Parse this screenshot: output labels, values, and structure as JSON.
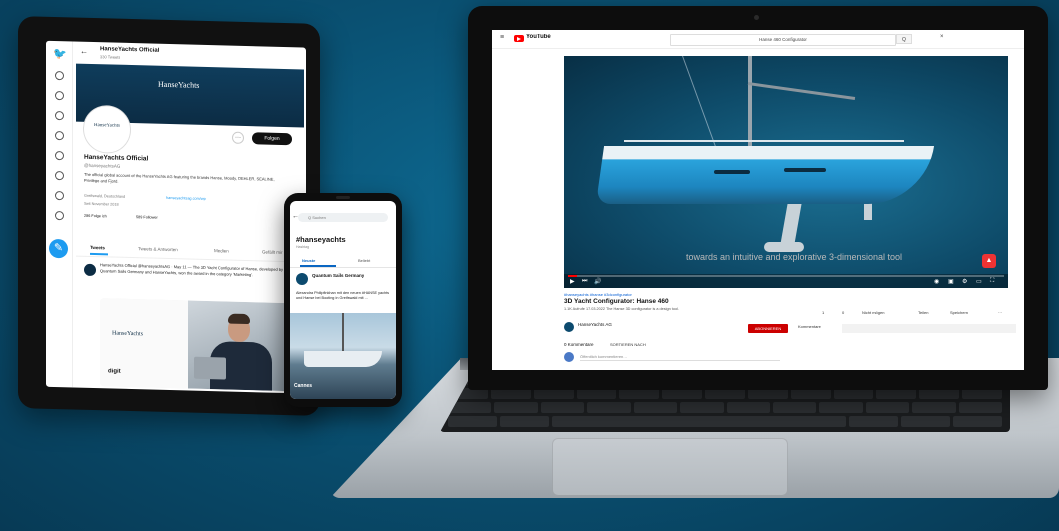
{
  "tablet": {
    "twitter": {
      "top_name": "HanseYachts Official",
      "top_sub": "330 Tweets",
      "banner_logo": "HanseYachts",
      "banner_sub": "",
      "avatar_text": "HanseYachts",
      "follow_label": "Folgen",
      "more_label": "···",
      "name": "HanseYachts Official",
      "handle": "@hanseyachtsAG",
      "bio": "The official global account of the HanseYachts AG featuring the brands Hanse, Moody, DEHLER, SEALINE, Privilège and Fjord.",
      "location": "Greifswald, Deutschland",
      "link": "hanseyachtsag.com/wp",
      "joined": "Seit November 2018",
      "following": "286 Folge ich",
      "followers": "589 Follower",
      "tabs": [
        "Tweets",
        "Tweets & Antworten",
        "Medien",
        "Gefällt mir"
      ],
      "post_text": "HanseYachts Official @hanseyachtsAG · May 11 — The 3D Yacht Configurator of Hanse, developed by Quantum Sails Germany and HanseYachts, won the award in the category 'Marketing'.",
      "media_logo": "HanseYachts",
      "media_sub": "",
      "media_brand": "digit"
    }
  },
  "phone": {
    "status_time": "",
    "status_icons": "",
    "search_placeholder": "Q Suchen",
    "hashtag": "#hanseyachts",
    "hashtag_sub": "Hashtag",
    "tabs": [
      "Neuste",
      "Beliebt"
    ],
    "author": "Quantum Sails Germany",
    "time": "",
    "text": "Alexandra Philipfinkhan mit den neuen #HANSE yachts und Hanse bei Booting in Greifswald mit ...",
    "image_caption": "Cannes"
  },
  "laptop": {
    "youtube": {
      "logo_text": "YouTube",
      "search_value": "Hanse 460 Configurator",
      "search_btn": "Q",
      "caption": "towards an intuitive and explorative 3-dimensional tool",
      "progress": 0.02,
      "hashtags": "#hanseyachts #hanse #3dconfigurator",
      "title": "3D Yacht Configurator: Hanse 460",
      "desc": "1.1K Aufrufe 17.03.2022 The Hanse 3D configurator is a design tool.",
      "actions": [
        "1",
        "0",
        "Teilen",
        "Speichern",
        "Nicht mögen",
        "···"
      ],
      "channel_name": "HanseYachts AG",
      "channel_subs": "",
      "subscribe": "ABONNIEREN",
      "comments_label": "Kommentare",
      "related": "",
      "comments_count": "0 Kommentare",
      "sort_label": "SORTIEREN NACH",
      "comment_placeholder": "Öffentlich kommentieren…"
    }
  }
}
